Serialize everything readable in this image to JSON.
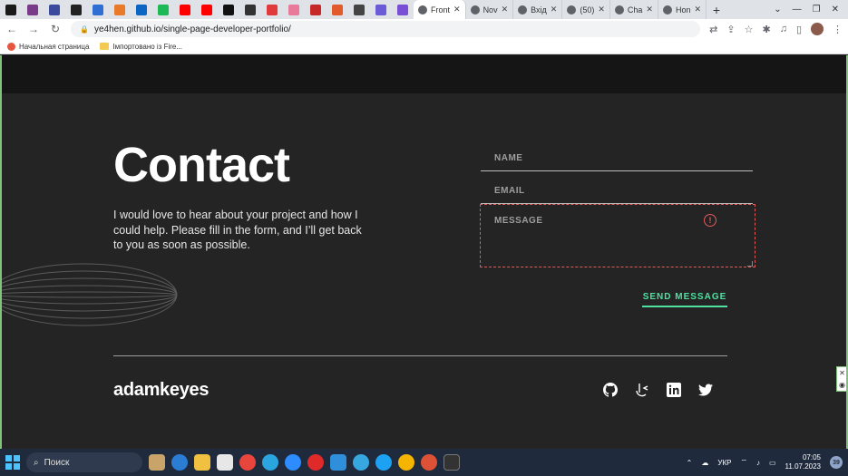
{
  "browser": {
    "pinned_tab_colors": [
      "#1a1a1a",
      "#7a3b88",
      "#3b4a9c",
      "#222222",
      "#2f6fd4",
      "#e87a2a",
      "#0a66c2",
      "#1db954",
      "#ff0000",
      "#ff0000",
      "#111111",
      "#333333",
      "#e03a3a",
      "#e87a9a",
      "#c62828",
      "#e25b2a",
      "#444444",
      "#6b5bd6",
      "#7a4fd6"
    ],
    "tabs": [
      {
        "label": "Front",
        "active": true
      },
      {
        "label": "Nov",
        "active": false
      },
      {
        "label": "Вхід",
        "active": false
      },
      {
        "label": "(50)",
        "active": false
      },
      {
        "label": "Cha",
        "active": false
      },
      {
        "label": "Hon",
        "active": false
      }
    ],
    "url": "ye4hen.github.io/single-page-developer-portfolio/",
    "bookmarks": [
      {
        "label": "Начальная страница"
      },
      {
        "label": "Імпортовано із Fire..."
      }
    ]
  },
  "page": {
    "title": "Contact",
    "description": "I would love to hear about your project and how I could help. Please fill in the form, and I’ll get back to you as soon as possible.",
    "form": {
      "name_placeholder": "NAME",
      "email_placeholder": "EMAIL",
      "message_placeholder": "MESSAGE",
      "send_label": "SEND MESSAGE",
      "error_icon": "!"
    },
    "footer": {
      "brand": "adamkeyes",
      "socials": [
        "github-icon",
        "frontend-mentor-icon",
        "linkedin-icon",
        "twitter-icon"
      ]
    },
    "colors": {
      "accent": "#4ee1a0",
      "error": "#e35a5a",
      "background": "#242424"
    }
  },
  "taskbar": {
    "search_label": "Поиск",
    "language": "УКР",
    "time": "07:05",
    "date": "11.07.2023",
    "notifications": "39"
  }
}
